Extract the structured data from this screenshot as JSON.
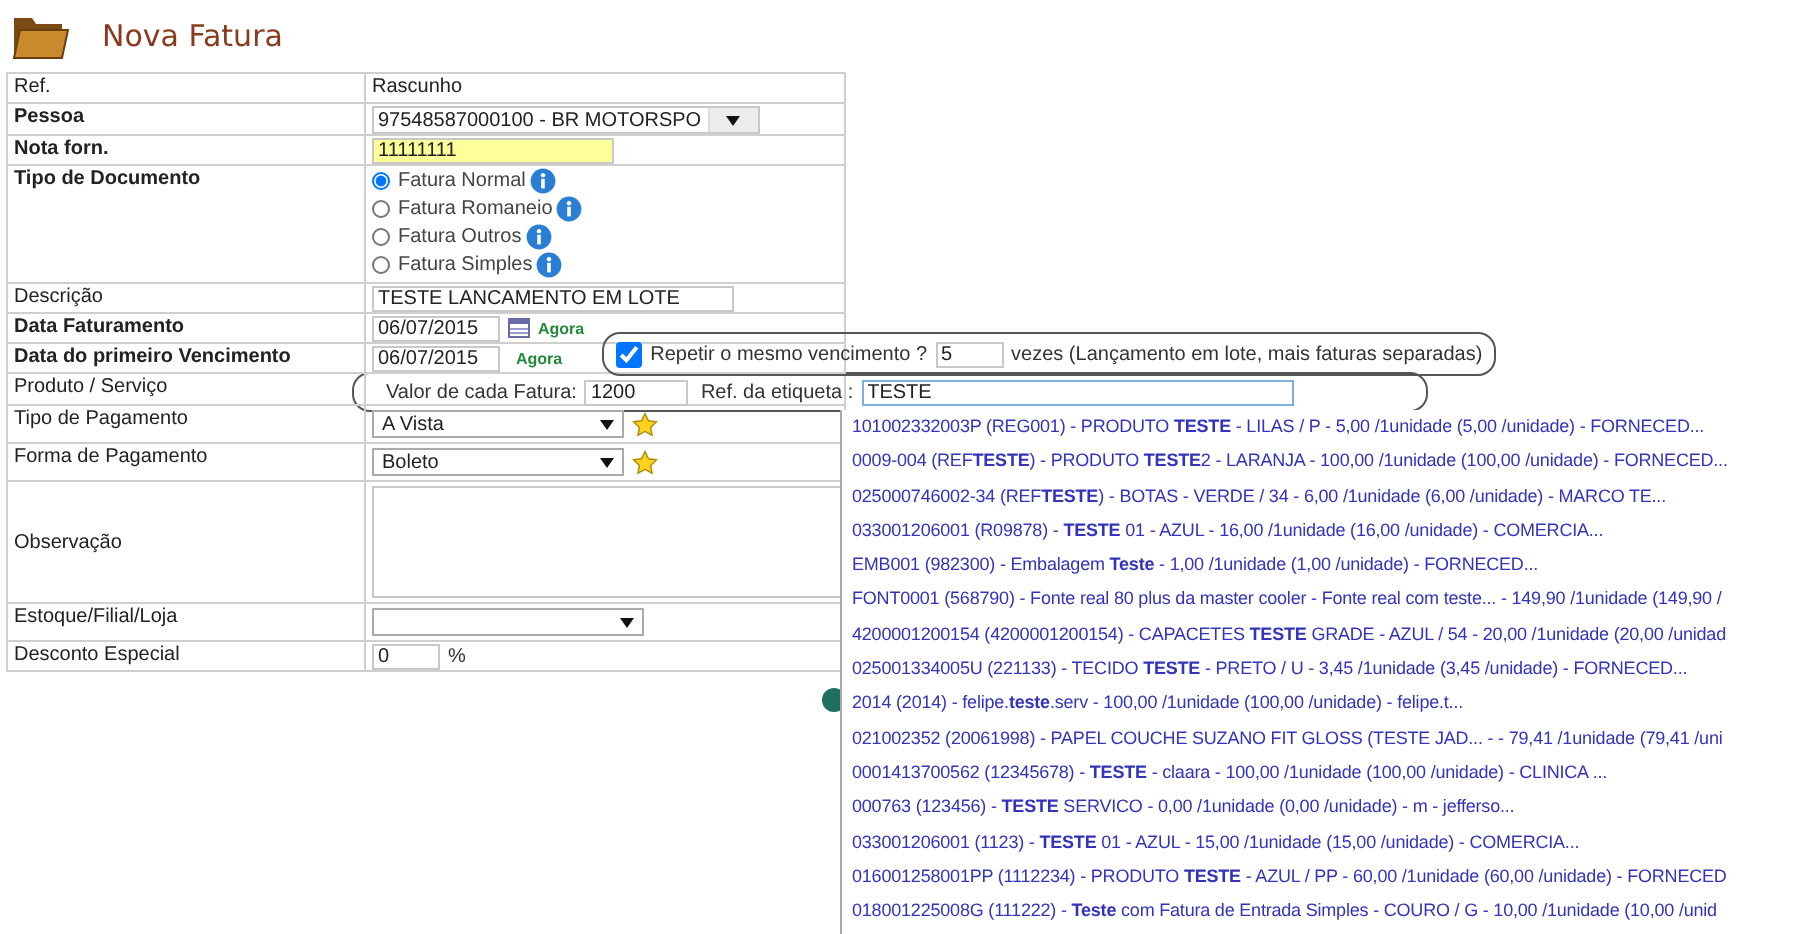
{
  "title": "Nova Fatura",
  "rows": [
    {
      "label": "Ref.",
      "required": false,
      "kind": "text",
      "value": "Rascunho"
    },
    {
      "label": "Pessoa",
      "required": true,
      "kind": "combo",
      "value": "97548587000100 - BR MOTORSPO"
    },
    {
      "label": "Nota forn.",
      "required": true,
      "kind": "input",
      "value": "11111111",
      "highlighted": true
    },
    {
      "label": "Tipo de Documento",
      "required": true,
      "kind": "radios",
      "options": [
        {
          "label": "Fatura Normal",
          "selected": true
        },
        {
          "label": "Fatura Romaneio",
          "selected": false
        },
        {
          "label": "Fatura Outros",
          "selected": false
        },
        {
          "label": "Fatura Simples",
          "selected": false
        }
      ]
    },
    {
      "label": "Descrição",
      "required": false,
      "kind": "input",
      "value": "TESTE LANCAMENTO EM LOTE",
      "highlighted": false
    },
    {
      "label": "Data Faturamento",
      "required": true,
      "kind": "date",
      "value": "06/07/2015",
      "link": "Agora"
    },
    {
      "label": "Data do primeiro Vencimento",
      "required": true,
      "kind": "date",
      "value": "06/07/2015",
      "link": "Agora",
      "repeat": {
        "checked": true,
        "label": "Repetir o mesmo vencimento ?",
        "count": "5",
        "suffix": "vezes (Lançamento em lote, mais faturas separadas)"
      }
    },
    {
      "label": "Produto / Serviço",
      "required": false,
      "kind": "lote",
      "fields": [
        {
          "label": "Valor de cada Fatura:",
          "value": "1200"
        },
        {
          "label": "Ref. da etiqueta :",
          "value": "TESTE"
        }
      ]
    },
    {
      "label": "Tipo de Pagamento",
      "required": false,
      "kind": "select",
      "value": "A Vista",
      "star": true
    },
    {
      "label": "Forma de Pagamento",
      "required": false,
      "kind": "select",
      "value": "Boleto",
      "star": true
    },
    {
      "label": "Observação",
      "required": false,
      "kind": "textarea"
    },
    {
      "label": "Estoque/Filial/Loja",
      "required": false,
      "kind": "select",
      "star": false
    },
    {
      "label": "Desconto Especial",
      "required": false,
      "kind": "percent",
      "value": "0",
      "suffix": "%"
    }
  ],
  "suggestions": [
    "101002332003P (REG001) - PRODUTO **TESTE** - LILAS / P - 5,00 /1unidade (5,00 /unidade) - FORNECED...",
    "0009-004 (REF**TESTE**) - PRODUTO **TESTE**2 - LARANJA - 100,00 /1unidade (100,00 /unidade) - FORNECED...",
    "025000746002-34 (REF**TESTE**) - BOTAS - VERDE / 34 - 6,00 /1unidade (6,00 /unidade) - MARCO TE...",
    "033001206001 (R09878) - **TESTE** 01 - AZUL - 16,00 /1unidade (16,00 /unidade) - COMERCIA...",
    "EMB001 (982300) - Embalagem **Teste** - 1,00 /1unidade (1,00 /unidade) - FORNECED...",
    "FONT0001 (568790) - Fonte real 80 plus da master cooler - Fonte real com teste... - 149,90 /1unidade (149,90 /",
    "4200001200154 (4200001200154) - CAPACETES **TESTE** GRADE - AZUL / 54 - 20,00 /1unidade (20,00 /unidad",
    "025001334005U (221133) - TECIDO **TESTE** - PRETO / U - 3,45 /1unidade (3,45 /unidade) - FORNECED...",
    "2014 (2014) - felipe.**teste**.serv - 100,00 /1unidade (100,00 /unidade) - felipe.t...",
    "021002352 (20061998) - PAPEL COUCHE SUZANO FIT GLOSS (TESTE JAD... -  - 79,41 /1unidade (79,41 /uni",
    "0001413700562 (12345678) - **TESTE** - claara - 100,00 /1unidade (100,00 /unidade) - CLINICA ...",
    "000763 (123456) - **TESTE** SERVICO - 0,00 /1unidade (0,00 /unidade) - m - jefferso...",
    "033001206001 (1123) - **TESTE** 01 - AZUL - 15,00 /1unidade (15,00 /unidade) - COMERCIA...",
    "016001258001PP (1112234) - PRODUTO **TESTE** - AZUL / PP - 60,00 /1unidade (60,00 /unidade) - FORNECED",
    "018001225008G (111222) - **Teste** com Fatura de Entrada Simples - COURO / G - 10,00 /1unidade (10,00 /unid"
  ]
}
